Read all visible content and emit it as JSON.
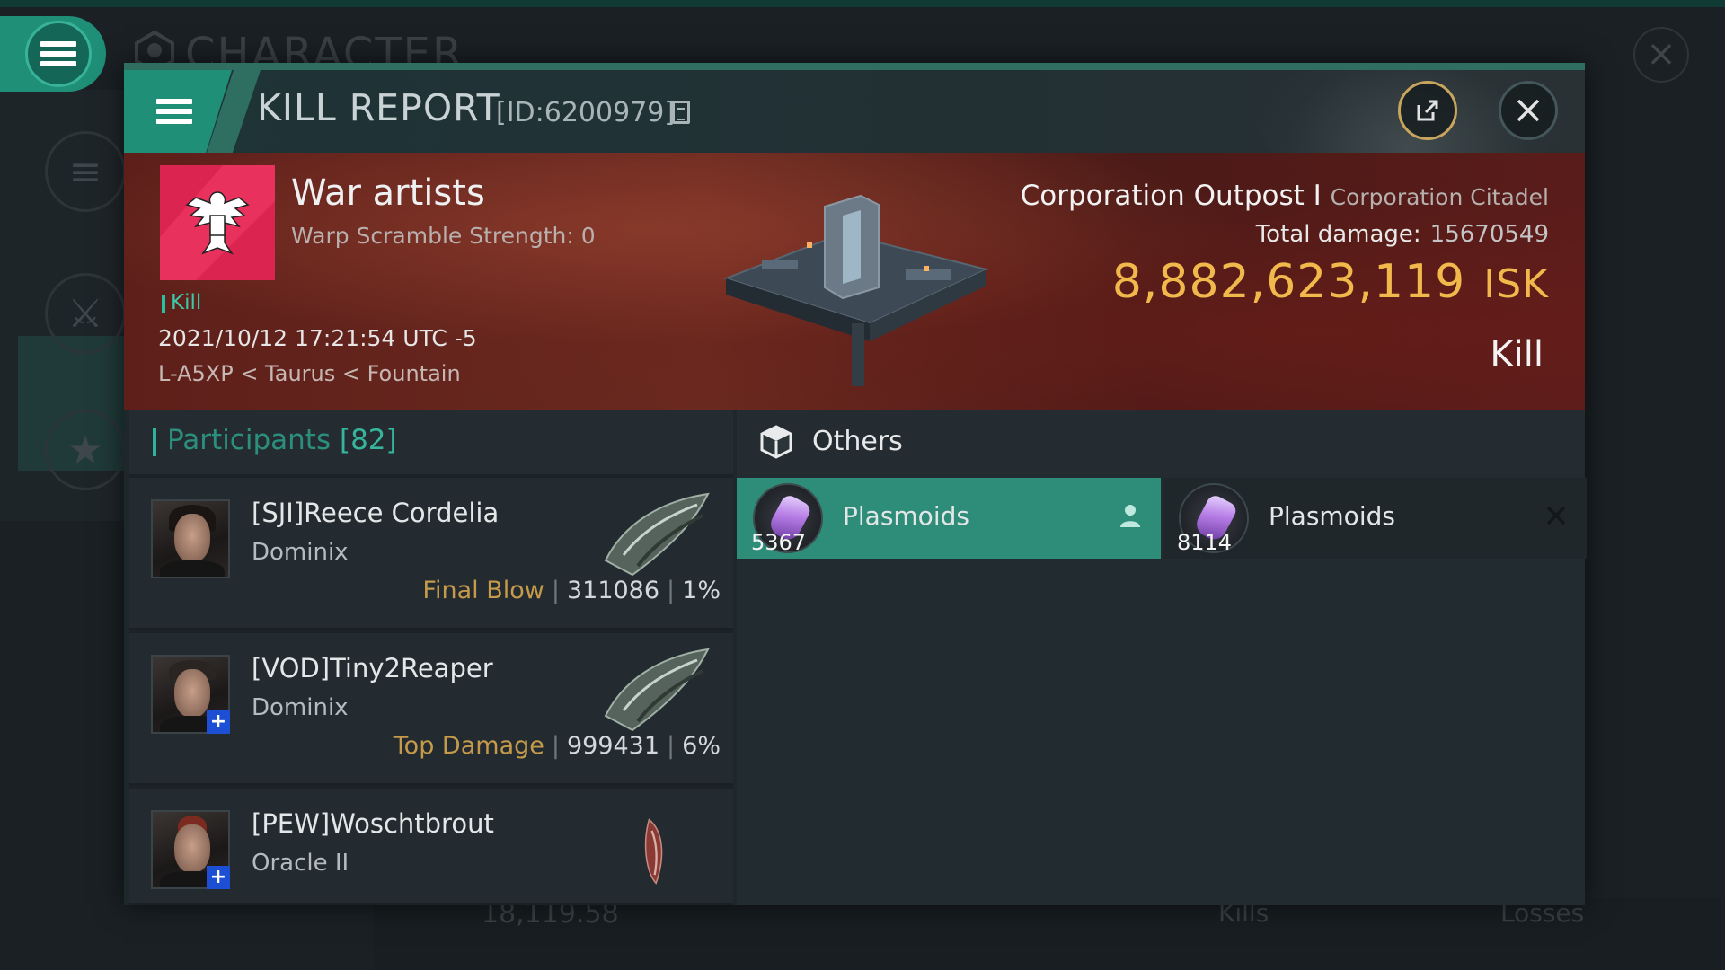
{
  "background": {
    "section_title": "CHARACTER",
    "bottom_value": "18,119.58",
    "bottom_kills_label": "Kills",
    "bottom_losses_label": "Losses"
  },
  "header": {
    "title": "KILL REPORT",
    "id_label": "[ID:6200979]"
  },
  "victim": {
    "name": "War artists",
    "warp_scramble": "Warp Scramble Strength: 0",
    "tag": "Kill",
    "timestamp": "2021/10/12 17:21:54 UTC -5",
    "location": "L-A5XP < Taurus < Fountain",
    "ship_name": "Corporation Outpost I",
    "ship_class": "Corporation Citadel",
    "total_damage_label": "Total damage:",
    "total_damage_value": "15670549",
    "isk_value": "8,882,623,119",
    "isk_unit": "ISK",
    "report_type": "Kill"
  },
  "participants": {
    "label": "Participants",
    "count": "[82]",
    "rows": [
      {
        "name": "[SJI]Reece Cordelia",
        "ship": "Dominix",
        "tag": "Final Blow",
        "damage": "311086",
        "percent": "1%",
        "has_plus": false,
        "ship_icon": "dominix-ship-icon"
      },
      {
        "name": "[VOD]Tiny2Reaper",
        "ship": "Dominix",
        "tag": "Top Damage",
        "damage": "999431",
        "percent": "6%",
        "has_plus": true,
        "ship_icon": "dominix-ship-icon"
      },
      {
        "name": "[PEW]Woschtbrout",
        "ship": "Oracle II",
        "has_plus": true,
        "ship_icon": "oracle-ship-icon"
      }
    ]
  },
  "others": {
    "title": "Others",
    "items": [
      {
        "name": "Plasmoids",
        "quantity": "5367",
        "action_icon": "person-icon"
      },
      {
        "name": "Plasmoids",
        "quantity": "8114",
        "action_icon": "x-icon"
      }
    ]
  },
  "colors": {
    "accent": "#2d8d79",
    "isk": "#f1b94b",
    "tag_gold": "#c59a4a",
    "banner_red": "#5e1f1a"
  }
}
